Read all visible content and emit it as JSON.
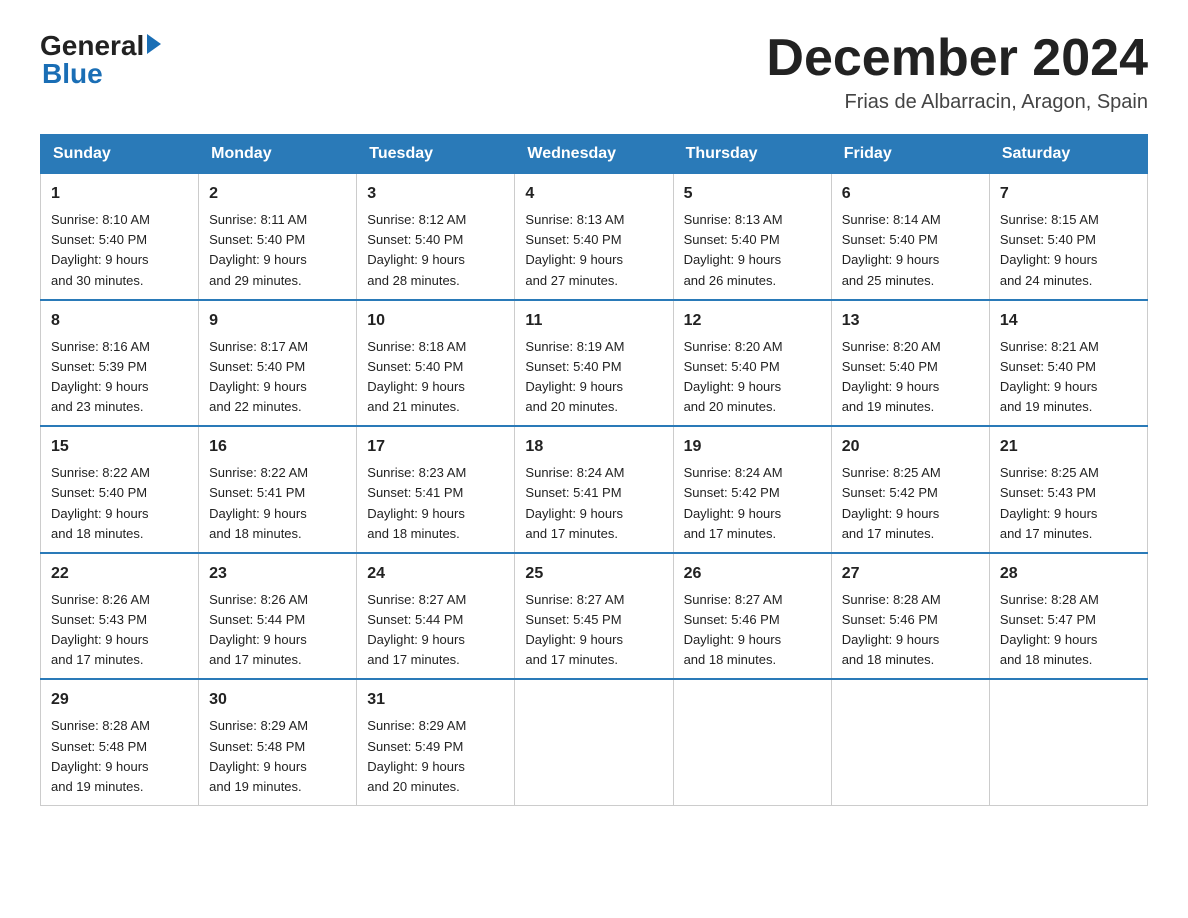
{
  "header": {
    "logo_general": "General",
    "logo_blue": "Blue",
    "month_title": "December 2024",
    "location": "Frias de Albarracin, Aragon, Spain"
  },
  "days_of_week": [
    "Sunday",
    "Monday",
    "Tuesday",
    "Wednesday",
    "Thursday",
    "Friday",
    "Saturday"
  ],
  "weeks": [
    [
      {
        "day": "1",
        "sunrise": "8:10 AM",
        "sunset": "5:40 PM",
        "daylight": "9 hours and 30 minutes."
      },
      {
        "day": "2",
        "sunrise": "8:11 AM",
        "sunset": "5:40 PM",
        "daylight": "9 hours and 29 minutes."
      },
      {
        "day": "3",
        "sunrise": "8:12 AM",
        "sunset": "5:40 PM",
        "daylight": "9 hours and 28 minutes."
      },
      {
        "day": "4",
        "sunrise": "8:13 AM",
        "sunset": "5:40 PM",
        "daylight": "9 hours and 27 minutes."
      },
      {
        "day": "5",
        "sunrise": "8:13 AM",
        "sunset": "5:40 PM",
        "daylight": "9 hours and 26 minutes."
      },
      {
        "day": "6",
        "sunrise": "8:14 AM",
        "sunset": "5:40 PM",
        "daylight": "9 hours and 25 minutes."
      },
      {
        "day": "7",
        "sunrise": "8:15 AM",
        "sunset": "5:40 PM",
        "daylight": "9 hours and 24 minutes."
      }
    ],
    [
      {
        "day": "8",
        "sunrise": "8:16 AM",
        "sunset": "5:39 PM",
        "daylight": "9 hours and 23 minutes."
      },
      {
        "day": "9",
        "sunrise": "8:17 AM",
        "sunset": "5:40 PM",
        "daylight": "9 hours and 22 minutes."
      },
      {
        "day": "10",
        "sunrise": "8:18 AM",
        "sunset": "5:40 PM",
        "daylight": "9 hours and 21 minutes."
      },
      {
        "day": "11",
        "sunrise": "8:19 AM",
        "sunset": "5:40 PM",
        "daylight": "9 hours and 20 minutes."
      },
      {
        "day": "12",
        "sunrise": "8:20 AM",
        "sunset": "5:40 PM",
        "daylight": "9 hours and 20 minutes."
      },
      {
        "day": "13",
        "sunrise": "8:20 AM",
        "sunset": "5:40 PM",
        "daylight": "9 hours and 19 minutes."
      },
      {
        "day": "14",
        "sunrise": "8:21 AM",
        "sunset": "5:40 PM",
        "daylight": "9 hours and 19 minutes."
      }
    ],
    [
      {
        "day": "15",
        "sunrise": "8:22 AM",
        "sunset": "5:40 PM",
        "daylight": "9 hours and 18 minutes."
      },
      {
        "day": "16",
        "sunrise": "8:22 AM",
        "sunset": "5:41 PM",
        "daylight": "9 hours and 18 minutes."
      },
      {
        "day": "17",
        "sunrise": "8:23 AM",
        "sunset": "5:41 PM",
        "daylight": "9 hours and 18 minutes."
      },
      {
        "day": "18",
        "sunrise": "8:24 AM",
        "sunset": "5:41 PM",
        "daylight": "9 hours and 17 minutes."
      },
      {
        "day": "19",
        "sunrise": "8:24 AM",
        "sunset": "5:42 PM",
        "daylight": "9 hours and 17 minutes."
      },
      {
        "day": "20",
        "sunrise": "8:25 AM",
        "sunset": "5:42 PM",
        "daylight": "9 hours and 17 minutes."
      },
      {
        "day": "21",
        "sunrise": "8:25 AM",
        "sunset": "5:43 PM",
        "daylight": "9 hours and 17 minutes."
      }
    ],
    [
      {
        "day": "22",
        "sunrise": "8:26 AM",
        "sunset": "5:43 PM",
        "daylight": "9 hours and 17 minutes."
      },
      {
        "day": "23",
        "sunrise": "8:26 AM",
        "sunset": "5:44 PM",
        "daylight": "9 hours and 17 minutes."
      },
      {
        "day": "24",
        "sunrise": "8:27 AM",
        "sunset": "5:44 PM",
        "daylight": "9 hours and 17 minutes."
      },
      {
        "day": "25",
        "sunrise": "8:27 AM",
        "sunset": "5:45 PM",
        "daylight": "9 hours and 17 minutes."
      },
      {
        "day": "26",
        "sunrise": "8:27 AM",
        "sunset": "5:46 PM",
        "daylight": "9 hours and 18 minutes."
      },
      {
        "day": "27",
        "sunrise": "8:28 AM",
        "sunset": "5:46 PM",
        "daylight": "9 hours and 18 minutes."
      },
      {
        "day": "28",
        "sunrise": "8:28 AM",
        "sunset": "5:47 PM",
        "daylight": "9 hours and 18 minutes."
      }
    ],
    [
      {
        "day": "29",
        "sunrise": "8:28 AM",
        "sunset": "5:48 PM",
        "daylight": "9 hours and 19 minutes."
      },
      {
        "day": "30",
        "sunrise": "8:29 AM",
        "sunset": "5:48 PM",
        "daylight": "9 hours and 19 minutes."
      },
      {
        "day": "31",
        "sunrise": "8:29 AM",
        "sunset": "5:49 PM",
        "daylight": "9 hours and 20 minutes."
      },
      null,
      null,
      null,
      null
    ]
  ],
  "labels": {
    "sunrise": "Sunrise:",
    "sunset": "Sunset:",
    "daylight": "Daylight:"
  }
}
